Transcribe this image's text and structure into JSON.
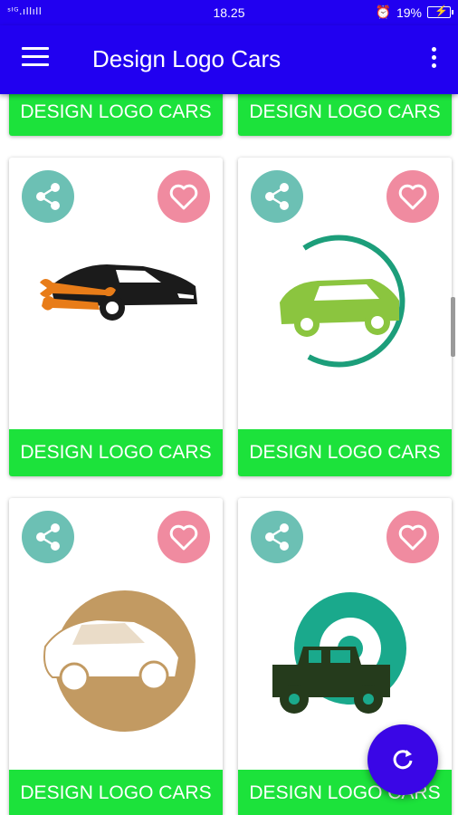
{
  "status_bar": {
    "signal": "ˢᴵᴳ.ıllıll",
    "time": "18.25",
    "battery": "19%"
  },
  "toolbar": {
    "title": "Design Logo Cars",
    "menu_icon": "hamburger-menu-icon",
    "overflow_icon": "more-vert-icon"
  },
  "cards": [
    {
      "label": "DESIGN LOGO CARS",
      "logo": "none"
    },
    {
      "label": "DESIGN LOGO CARS",
      "logo": "none"
    },
    {
      "label": "DESIGN LOGO CARS",
      "logo": "sports-car-wrench-logo"
    },
    {
      "label": "DESIGN LOGO CARS",
      "logo": "green-car-circle-logo"
    },
    {
      "label": "DESIGN LOGO CARS",
      "logo": "tan-sedan-circle-logo"
    },
    {
      "label": "DESIGN LOGO CARS",
      "logo": "jeep-tire-logo"
    }
  ],
  "colors": {
    "primary": "#2100f0",
    "label_green": "#1ce23b",
    "share": "#6cc0b4",
    "favorite": "#f08ba0",
    "fab": "#3a06e6"
  },
  "fab": {
    "icon": "refresh-icon"
  }
}
